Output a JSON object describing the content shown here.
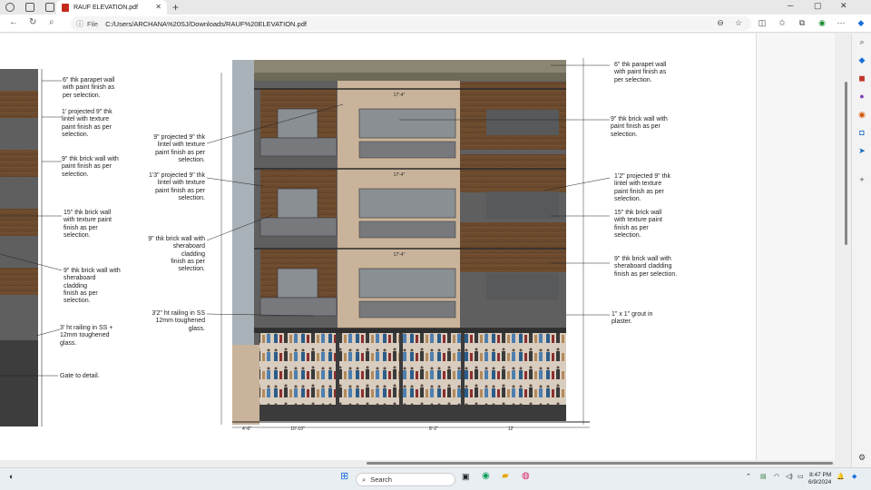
{
  "browser": {
    "tab_title": "RAUF ELEVATION.pdf",
    "url_label": "File",
    "url": "C:/Users/ARCHANA%20SJ/Downloads/RAUF%20ELEVATION.pdf"
  },
  "drawing": {
    "left_notes": [
      "6\" thk parapet wall\nwith paint finish as\nper selection.",
      "1' projected 9\" thk\nlintel with texture\npaint finish as per\nselection.",
      "9\" thk brick wall with\npaint finish as per\nselection.",
      "15\" thk brick wall\nwith texture paint\nfinish as per\nselection.",
      "9\" thk brick wall with\nsheraboard\ncladding\nfinish as per\nselection.",
      "3' ht railing in SS +\n12mm toughened\nglass.",
      "Gate to detail."
    ],
    "mid_notes": [
      "9\" projected 9\" thk\nlintel with texture\npaint finish as per\nselection.",
      "1'3\" projected 9\" thk\nlintel with texture\npaint finish as per\nselection.",
      "9\" thk brick wall with\nsheraboard\ncladding\nfinish as per\nselection.",
      "3'2\" ht railing in SS\n12mm toughened\nglass."
    ],
    "right_notes": [
      "6\" thk parapet wall\nwith paint finish as\nper selection.",
      "9\" thk brick wall with\npaint finish as per\nselection.",
      "1'2\" projected 9\" thk\nlintel with texture\npaint finish as per\nselection.",
      "15\" thk brick wall\nwith texture paint\nfinish as per\nselection.",
      "9\" thk brick wall with\nsheraboard cladding\nfinish as per selection.",
      "1\" x 1\" grout in\nplaster."
    ],
    "floor_dims": [
      "17'-4\"",
      "17'-4\"",
      "17'-4\""
    ],
    "bottom_dims": [
      "4'-6\"",
      "10'-10\"",
      "8'-2\"",
      "12'"
    ]
  },
  "taskbar": {
    "search_placeholder": "Search",
    "time": "8:47 PM",
    "date": "6/9/2024"
  },
  "colors": {
    "wood": "#6b4a2e",
    "concrete": "#5f5f5f",
    "glass": "#8a8f93",
    "beige": "#c9b39a",
    "pdf_red": "#c42b1c"
  }
}
